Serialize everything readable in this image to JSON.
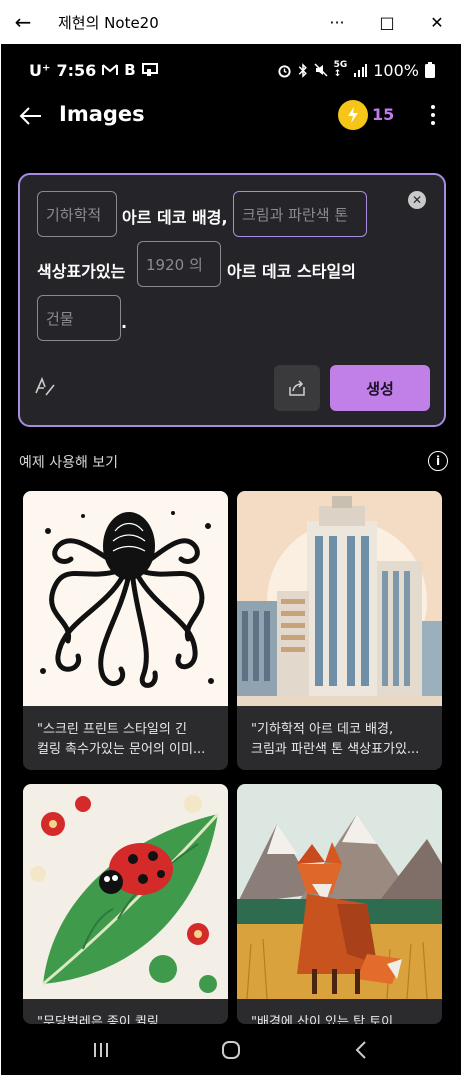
{
  "window": {
    "title": "제현의 Note20",
    "back_glyph": "←",
    "more_glyph": "···",
    "maximize_glyph": "□",
    "close_glyph": "✕"
  },
  "status": {
    "carrier": "U⁺",
    "time": "7:56",
    "battery": "100%",
    "icons_left": [
      "gmail-icon",
      "b-icon",
      "screen-icon"
    ],
    "icons_right": [
      "alarm-icon",
      "bluetooth-icon",
      "mute-icon",
      "5g-icon",
      "signal-icon",
      "battery-icon"
    ]
  },
  "appbar": {
    "title": "Images",
    "credits": "15",
    "coin_icon": "lightning-coin-icon"
  },
  "prompt": {
    "slot1_placeholder": "기하학적",
    "text1": "아르 데코 배경,",
    "slot2_placeholder": "크림과 파란색 톤",
    "text2": "색상표가있는",
    "slot3_placeholder": "1920 의",
    "text3": "아르 데코 스타일의",
    "slot4_placeholder": "건물",
    "text4": ".",
    "clear_glyph": "✕",
    "generate_label": "생성"
  },
  "examples": {
    "heading": "예제 사용해 보기",
    "cards": [
      {
        "line1": "\"스크린 프린트 스타일의 긴",
        "line2": "컬링 촉수가있는 문어의 이미..."
      },
      {
        "line1": "\"기하학적 아르 데코 배경,",
        "line2": "크림과 파란색 톤 색상표가있..."
      },
      {
        "line1": "\"무당벌레은 종이 퀼링",
        "line2": ""
      },
      {
        "line1": "\"배경에 산이 있는 탑 토이",
        "line2": ""
      }
    ]
  },
  "colors": {
    "accent": "#c17fe8",
    "border": "#a98be0",
    "coin": "#f5c518"
  }
}
